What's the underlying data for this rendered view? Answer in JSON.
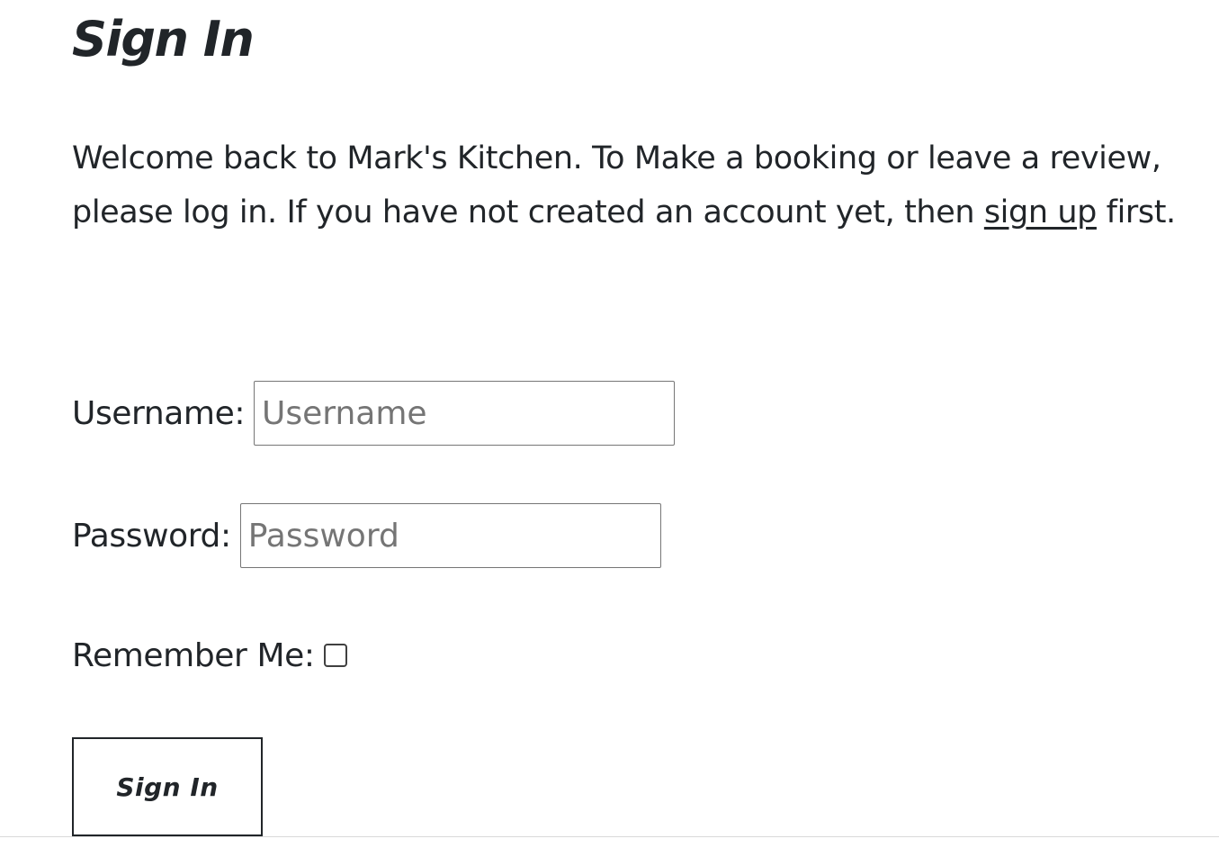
{
  "page": {
    "title": "Sign In"
  },
  "intro": {
    "text_before_link": "Welcome back to Mark's Kitchen. To Make a booking or leave a review, please log in. If you have not created an account yet, then ",
    "signup_link": "sign up",
    "text_after_link": " first."
  },
  "form": {
    "username_label": "Username:",
    "username_placeholder": "Username",
    "username_value": "",
    "password_label": "Password:",
    "password_placeholder": "Password",
    "password_value": "",
    "remember_label": "Remember Me:",
    "remember_checked": false,
    "submit_label": "Sign In"
  }
}
